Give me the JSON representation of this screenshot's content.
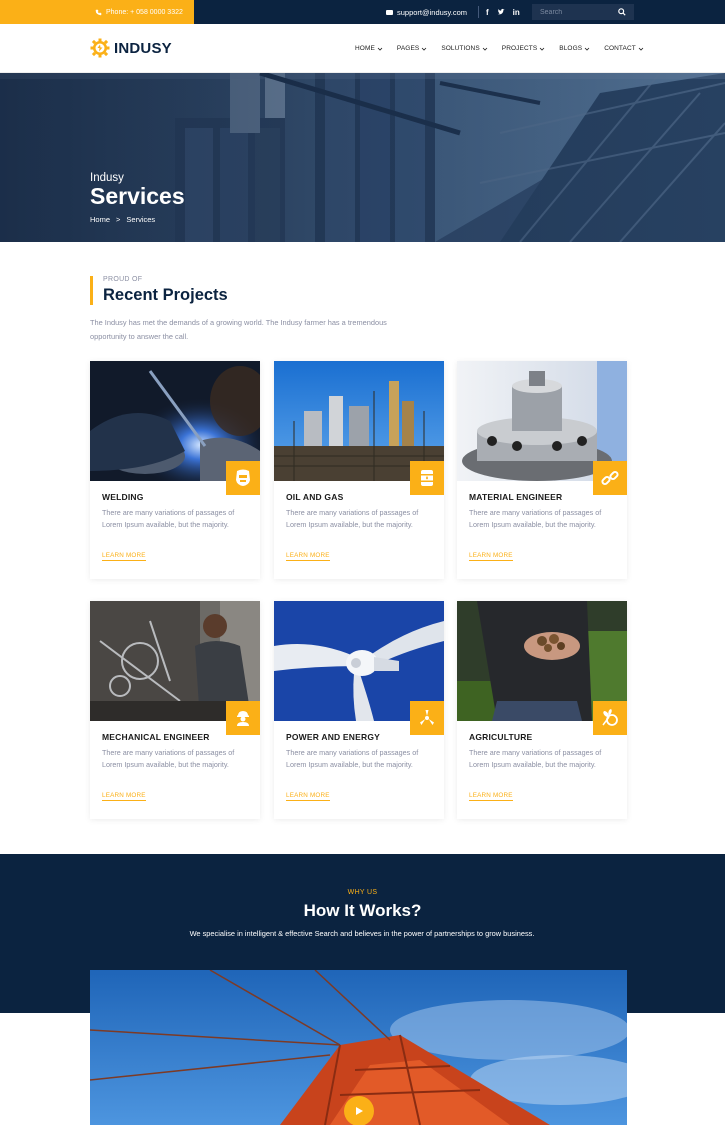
{
  "topbar": {
    "phone": "Phone: + 058 0000 3322",
    "email": "support@indusy.com",
    "social": [
      "f",
      "t",
      "in"
    ],
    "search_placeholder": "Search"
  },
  "header": {
    "logo_text": "INDUSY",
    "nav": [
      "HOME",
      "PAGES",
      "SOLUTIONS",
      "PROJECTS",
      "BLOGS",
      "CONTACT"
    ]
  },
  "hero": {
    "subtitle": "Indusy",
    "title": "Services",
    "breadcrumb_home": "Home",
    "breadcrumb_sep": ">",
    "breadcrumb_current": "Services"
  },
  "projects": {
    "eyebrow": "PROUD OF",
    "title": "Recent Projects",
    "description": "The Indusy has met the demands of a growing world. The Indusy farmer has a tremendous opportunity to answer the call.",
    "cards": [
      {
        "title": "WELDING",
        "description": "There are many variations of passages of Lorem Ipsum available, but the majority.",
        "link": "LEARN MORE",
        "icon": "welding-mask-icon"
      },
      {
        "title": "OIL AND GAS",
        "description": "There are many variations of passages of Lorem Ipsum available, but the majority.",
        "link": "LEARN MORE",
        "icon": "oil-barrel-icon"
      },
      {
        "title": "MATERIAL ENGINEER",
        "description": "There are many variations of passages of Lorem Ipsum available, but the majority.",
        "link": "LEARN MORE",
        "icon": "chain-icon"
      },
      {
        "title": "MECHANICAL ENGINEER",
        "description": "There are many variations of passages of Lorem Ipsum available, but the majority.",
        "link": "LEARN MORE",
        "icon": "worker-icon"
      },
      {
        "title": "POWER AND ENERGY",
        "description": "There are many variations of passages of Lorem Ipsum available, but the majority.",
        "link": "LEARN MORE",
        "icon": "wind-turbine-icon"
      },
      {
        "title": "AGRICULTURE",
        "description": "There are many variations of passages of Lorem Ipsum available, but the majority.",
        "link": "LEARN MORE",
        "icon": "wheat-icon"
      }
    ]
  },
  "how": {
    "eyebrow": "WHY US",
    "title": "How It Works?",
    "description": "We specialise in intelligent & effective Search and believes in the power of partnerships to grow business."
  },
  "colors": {
    "accent": "#fbb017",
    "navy": "#0b2340",
    "muted": "#8b8fa3"
  }
}
